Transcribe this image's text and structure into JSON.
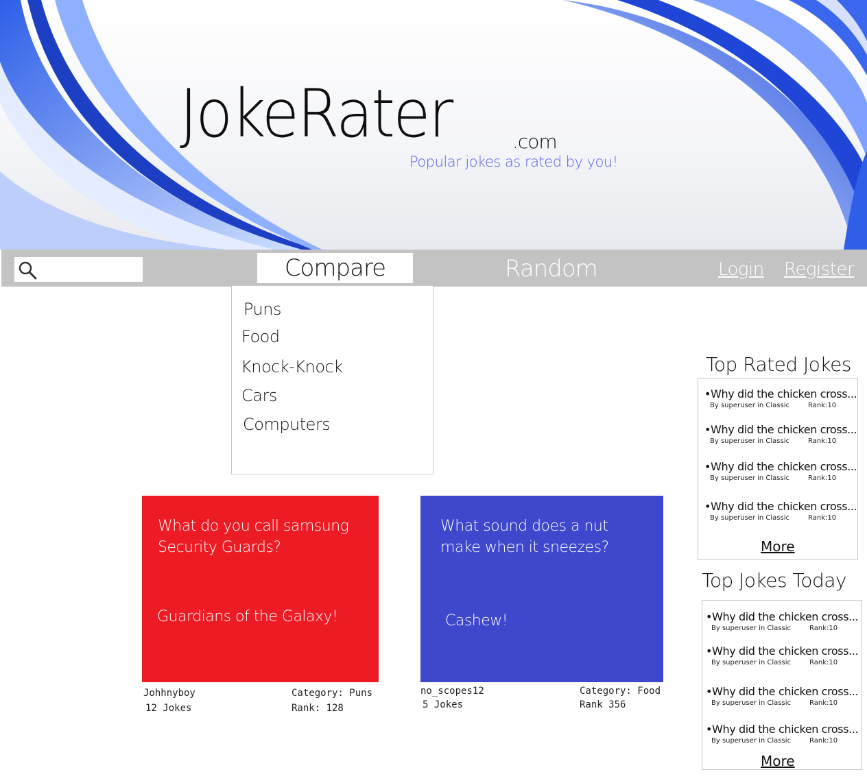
{
  "banner": {
    "logo": "JokeRater",
    "logo_tld": ".com",
    "tagline": "Popular jokes as rated by you!"
  },
  "nav": {
    "search_placeholder": "",
    "compare_label": "Compare",
    "random_label": "Random",
    "login_label": "Login",
    "register_label": "Register"
  },
  "dropdown": {
    "items": [
      "Puns",
      "Food",
      "Knock-Knock",
      "Cars",
      "Computers"
    ]
  },
  "cards": [
    {
      "question": "What do you call samsung Security Guards?",
      "answer": "Guardians of the Galaxy!",
      "author": "Johhnyboy",
      "jokes": "12 Jokes",
      "category": "Category: Puns",
      "rank": "Rank: 128",
      "color": "#ed1c24"
    },
    {
      "question": "What sound does a nut make when it sneezes?",
      "answer": "Cashew!",
      "author": "no_scopes12",
      "jokes": "5 Jokes",
      "category": "Category: Food",
      "rank": "Rank 356",
      "color": "#3f48cc"
    }
  ],
  "sidebar": {
    "top_rated_title": "Top Rated Jokes",
    "top_today_title": "Top Jokes Today",
    "top_rated": [
      {
        "joke": "•Why did the chicken cross...",
        "info": "By superuser in Classic",
        "rank": "Rank:10"
      },
      {
        "joke": "•Why did the chicken cross...",
        "info": "By superuser in Classic",
        "rank": "Rank:10"
      },
      {
        "joke": "•Why did the chicken cross...",
        "info": "By superuser in Classic",
        "rank": "Rank:10"
      },
      {
        "joke": "•Why did the chicken cross...",
        "info": "By superuser in Classic",
        "rank": "Rank:10"
      }
    ],
    "top_today": [
      {
        "joke": "•Why did the chicken cross...",
        "info": "By superuser in Classic",
        "rank": "Rank:10"
      },
      {
        "joke": "•Why did the chicken cross...",
        "info": "By superuser in Classic",
        "rank": "Rank:10"
      },
      {
        "joke": "•Why did the chicken cross...",
        "info": "By superuser in Classic",
        "rank": "Rank:10"
      },
      {
        "joke": "•Why did the chicken cross...",
        "info": "By superuser in Classic",
        "rank": "Rank:10"
      }
    ],
    "more_label": "More"
  },
  "colors": {
    "accent_blue": "#3a6df0",
    "nav_gray": "#c3c3c3",
    "tagline": "#5a5ce8"
  }
}
